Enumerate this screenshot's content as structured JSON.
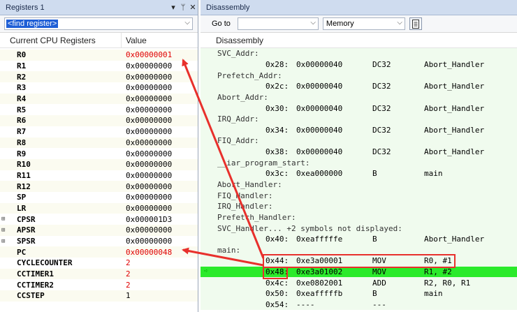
{
  "registers_panel": {
    "title": "Registers 1",
    "controls": [
      "▾",
      "ᛘ",
      "✕"
    ],
    "find_placeholder": "<find register>",
    "col_name": "Current CPU Registers",
    "col_value": "Value",
    "rows": [
      {
        "name": "R0",
        "value": "0x00000001",
        "changed": true
      },
      {
        "name": "R1",
        "value": "0x00000000"
      },
      {
        "name": "R2",
        "value": "0x00000000"
      },
      {
        "name": "R3",
        "value": "0x00000000"
      },
      {
        "name": "R4",
        "value": "0x00000000"
      },
      {
        "name": "R5",
        "value": "0x00000000"
      },
      {
        "name": "R6",
        "value": "0x00000000"
      },
      {
        "name": "R7",
        "value": "0x00000000"
      },
      {
        "name": "R8",
        "value": "0x00000000"
      },
      {
        "name": "R9",
        "value": "0x00000000"
      },
      {
        "name": "R10",
        "value": "0x00000000"
      },
      {
        "name": "R11",
        "value": "0x00000000"
      },
      {
        "name": "R12",
        "value": "0x00000000"
      },
      {
        "name": "SP",
        "value": "0x00000000"
      },
      {
        "name": "LR",
        "value": "0x00000000"
      },
      {
        "name": "CPSR",
        "value": "0x000001D3",
        "expand": "⊞"
      },
      {
        "name": "APSR",
        "value": "0x00000000",
        "expand": "⊞"
      },
      {
        "name": "SPSR",
        "value": "0x00000000",
        "expand": "⊞"
      },
      {
        "name": "PC",
        "value": "0x00000048",
        "changed": true
      },
      {
        "name": "CYCLECOUNTER",
        "value": "2",
        "changed": true
      },
      {
        "name": "CCTIMER1",
        "value": "2",
        "changed": true
      },
      {
        "name": "CCTIMER2",
        "value": "2",
        "changed": true
      },
      {
        "name": "CCSTEP",
        "value": "1"
      }
    ]
  },
  "disassembly_panel": {
    "title": "Disassembly",
    "goto_label": "Go to",
    "goto_value": "",
    "memory_label": "Memory",
    "header": "Disassembly",
    "rows": [
      {
        "type": "label",
        "text": "SVC_Addr:"
      },
      {
        "type": "ins",
        "addr": "0x28:",
        "code": "0x00000040",
        "mn": "DC32",
        "op": "Abort_Handler"
      },
      {
        "type": "label",
        "text": "Prefetch_Addr:"
      },
      {
        "type": "ins",
        "addr": "0x2c:",
        "code": "0x00000040",
        "mn": "DC32",
        "op": "Abort_Handler"
      },
      {
        "type": "label",
        "text": "Abort_Addr:"
      },
      {
        "type": "ins",
        "addr": "0x30:",
        "code": "0x00000040",
        "mn": "DC32",
        "op": "Abort_Handler"
      },
      {
        "type": "label",
        "text": "IRQ_Addr:"
      },
      {
        "type": "ins",
        "addr": "0x34:",
        "code": "0x00000040",
        "mn": "DC32",
        "op": "Abort_Handler"
      },
      {
        "type": "label",
        "text": "FIQ_Addr:"
      },
      {
        "type": "ins",
        "addr": "0x38:",
        "code": "0x00000040",
        "mn": "DC32",
        "op": "Abort_Handler"
      },
      {
        "type": "label",
        "text": "__iar_program_start:"
      },
      {
        "type": "ins",
        "addr": "0x3c:",
        "code": "0xea000000",
        "mn": "B",
        "op": "main"
      },
      {
        "type": "label",
        "text": "Abort_Handler:"
      },
      {
        "type": "label",
        "text": "FIQ_Handler:"
      },
      {
        "type": "label",
        "text": "IRQ_Handler:"
      },
      {
        "type": "label",
        "text": "Prefetch_Handler:"
      },
      {
        "type": "label",
        "text": "SVC_Handler... +2 symbols not displayed:"
      },
      {
        "type": "ins",
        "addr": "0x40:",
        "code": "0xeafffffe",
        "mn": "B",
        "op": "Abort_Handler"
      },
      {
        "type": "label",
        "text": "main:"
      },
      {
        "type": "ins",
        "addr": "0x44:",
        "code": "0xe3a00001",
        "mn": "MOV",
        "op": "R0, #1"
      },
      {
        "type": "ins",
        "addr": "0x48:",
        "code": "0xe3a01002",
        "mn": "MOV",
        "op": "R1, #2",
        "current": true
      },
      {
        "type": "ins",
        "addr": "0x4c:",
        "code": "0xe0802001",
        "mn": "ADD",
        "op": "R2, R0, R1"
      },
      {
        "type": "ins",
        "addr": "0x50:",
        "code": "0xeafffffb",
        "mn": "B",
        "op": "main"
      },
      {
        "type": "ins",
        "addr": "0x54:",
        "code": "----",
        "mn": "---",
        "op": ""
      }
    ]
  },
  "colors": {
    "changed": "#e00000",
    "current_line": "#2bea2b",
    "annotation": "#e8302c"
  },
  "icons": {
    "current_pc_icon": "➪",
    "memory_toggle_icon": "document-icon"
  }
}
